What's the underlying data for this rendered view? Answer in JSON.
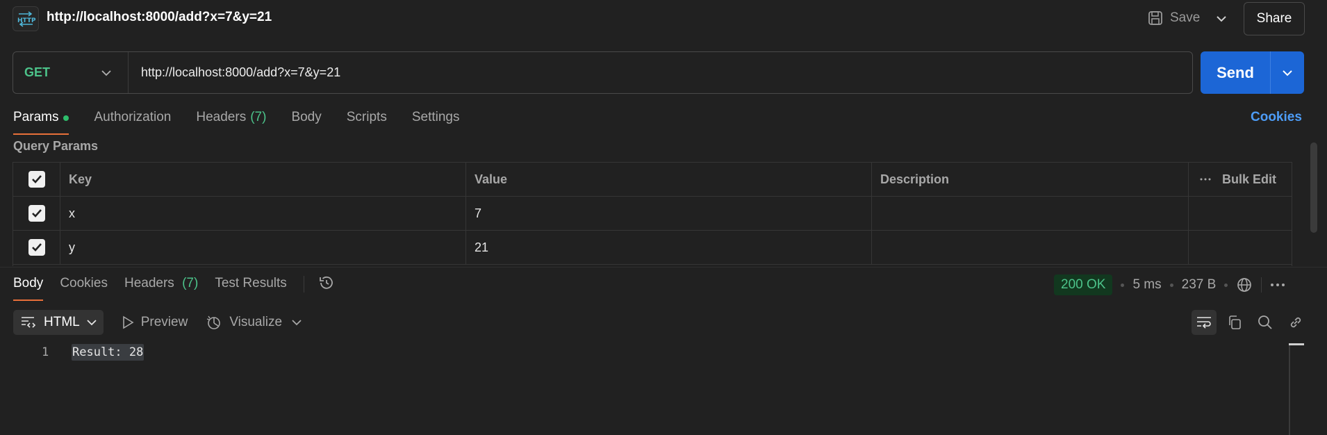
{
  "header": {
    "title": "http://localhost:8000/add?x=7&y=21",
    "save_label": "Save",
    "share_label": "Share"
  },
  "request": {
    "method": "GET",
    "url": "http://localhost:8000/add?x=7&y=21",
    "send_label": "Send"
  },
  "tabs": {
    "params": "Params",
    "authorization": "Authorization",
    "headers": "Headers",
    "headers_count": "(7)",
    "body": "Body",
    "scripts": "Scripts",
    "settings": "Settings",
    "cookies": "Cookies"
  },
  "query_params": {
    "title": "Query Params",
    "columns": {
      "key": "Key",
      "value": "Value",
      "description": "Description",
      "bulk_edit": "Bulk Edit"
    },
    "rows": [
      {
        "key": "x",
        "value": "7",
        "description": "",
        "checked": true
      },
      {
        "key": "y",
        "value": "21",
        "description": "",
        "checked": true
      }
    ]
  },
  "response": {
    "tabs": {
      "body": "Body",
      "cookies": "Cookies",
      "headers": "Headers",
      "headers_count": "(7)",
      "test_results": "Test Results"
    },
    "status": "200 OK",
    "time": "5 ms",
    "size": "237 B",
    "format": "HTML",
    "preview_label": "Preview",
    "visualize_label": "Visualize",
    "line_number": "1",
    "body_text": "Result: 28"
  },
  "colors": {
    "accent": "#e8703a",
    "send": "#1c66d6",
    "method_get": "#4cc38a",
    "link": "#4d9cf6"
  }
}
